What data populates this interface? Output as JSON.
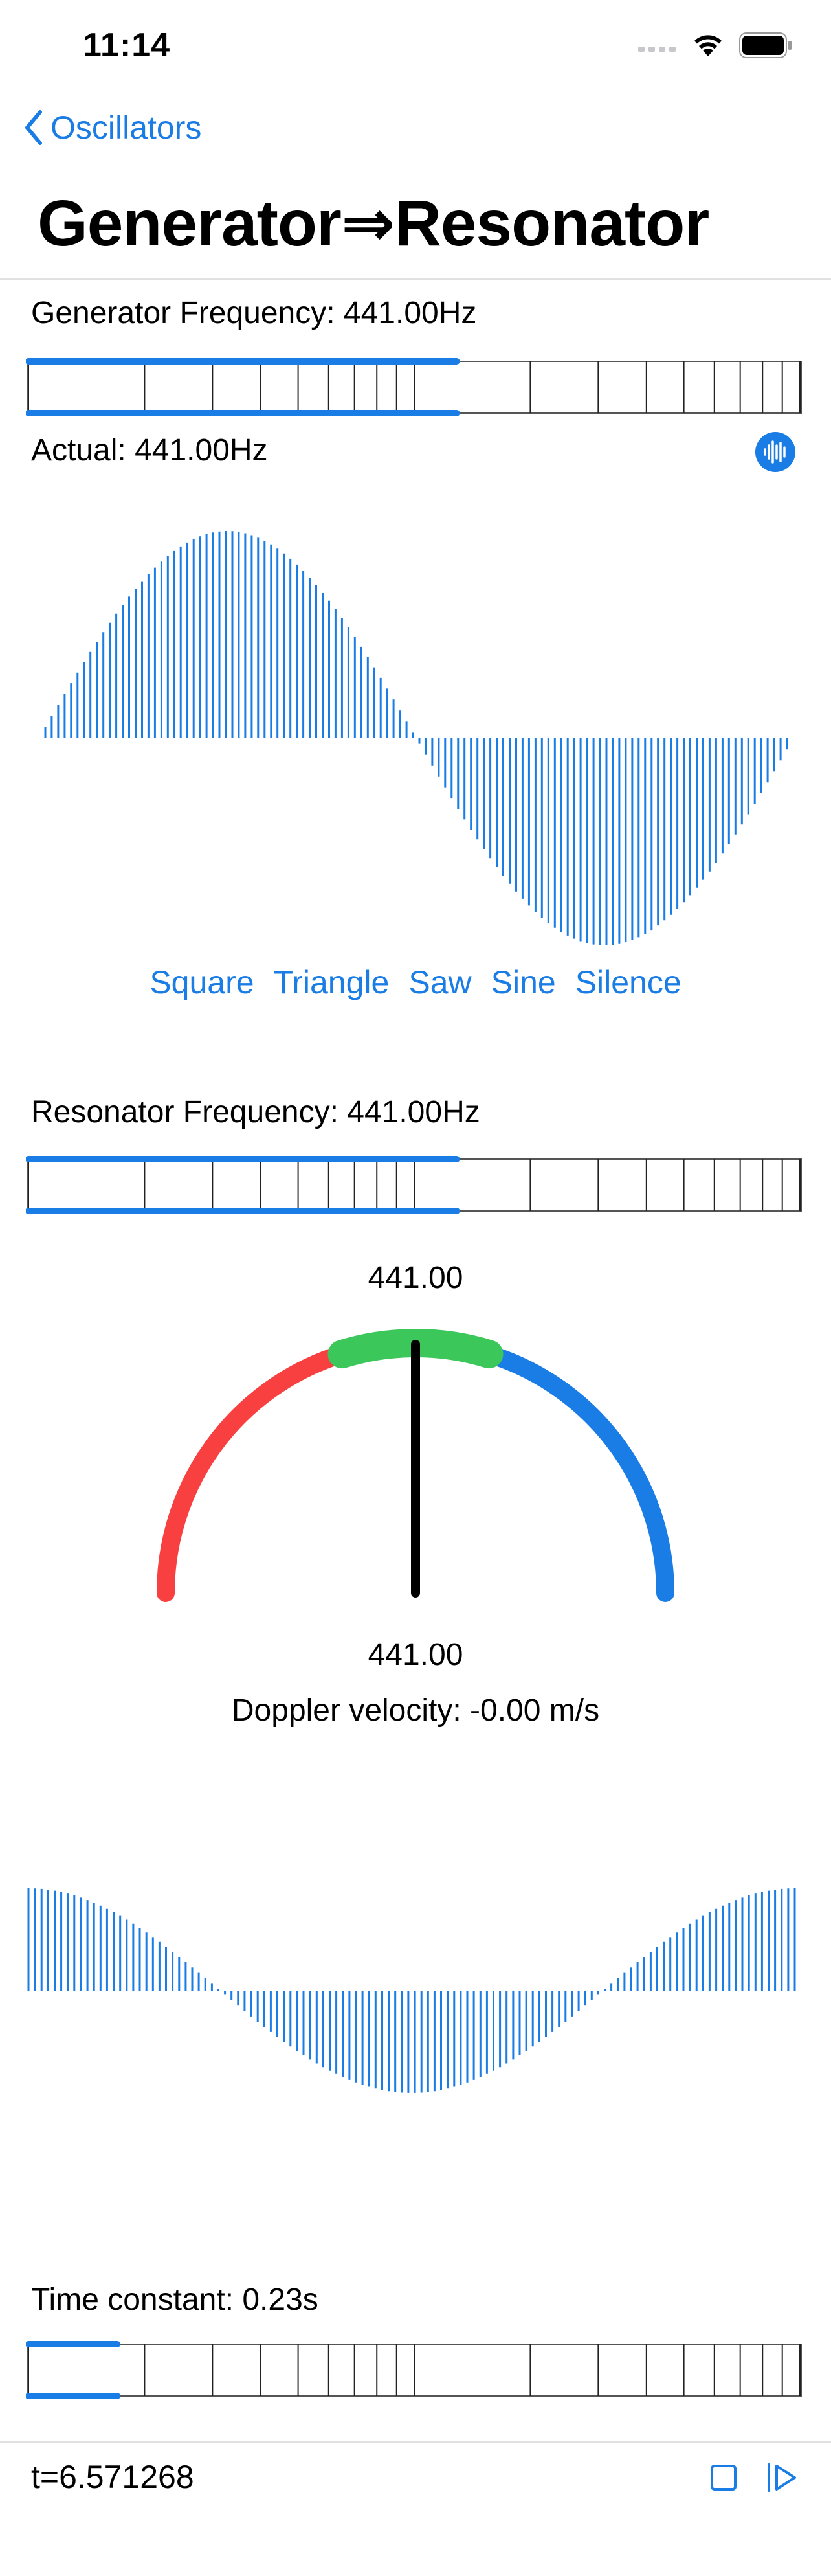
{
  "status_bar": {
    "time": "11:14"
  },
  "nav": {
    "back_label": "Oscillators",
    "title": "Generator⇒Resonator"
  },
  "generator": {
    "frequency_label": "Generator Frequency: 441.00Hz",
    "actual_label": "Actual: 441.00Hz",
    "slider_fraction": 0.555
  },
  "waveform_buttons": [
    "Square",
    "Triangle",
    "Saw",
    "Sine",
    "Silence"
  ],
  "resonator": {
    "frequency_label": "Resonator Frequency: 441.00Hz",
    "slider_fraction": 0.555
  },
  "gauge": {
    "top_value": "441.00",
    "bottom_value": "441.00",
    "doppler_label": "Doppler velocity: -0.00 m/s",
    "colors": {
      "low": "#f94040",
      "match": "#3cc75a",
      "high": "#1a7ce5",
      "needle": "#000000"
    }
  },
  "time_constant": {
    "label": "Time constant: 0.23s",
    "slider_fraction": 0.115
  },
  "footer": {
    "time_readout": "t=6.571268"
  },
  "icons": {
    "back": "chevron-left-icon",
    "audio": "waveform-icon",
    "stop": "stop-icon",
    "step": "step-forward-icon"
  },
  "accent_color": "#1a7ce5"
}
